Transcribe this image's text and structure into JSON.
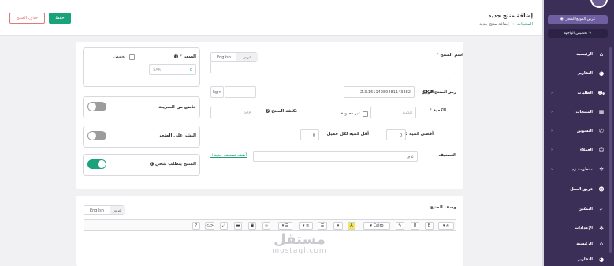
{
  "header": {
    "page_title": "إضافة منتج جديد",
    "breadcrumb": {
      "parent": "المنتجات",
      "current": "إضافة منتج جديد"
    },
    "save_label": "حفظ",
    "delete_label": "حذف المنتج"
  },
  "sidebar": {
    "store_button": "عرض الموقع/المتجر",
    "sub_item": "تخصيص الواجهة",
    "items": [
      {
        "label": "الرئيسية",
        "icon": "home-icon"
      },
      {
        "label": "التقارير",
        "icon": "chart-icon"
      },
      {
        "label": "الطلبات",
        "icon": "cart-icon"
      },
      {
        "label": "المنتجات",
        "icon": "grid-icon"
      },
      {
        "label": "التسويق",
        "icon": "megaphone-icon"
      },
      {
        "label": "العملاء",
        "icon": "users-icon"
      },
      {
        "label": "منظومة زد",
        "icon": "network-icon"
      },
      {
        "label": "فريق العمل",
        "icon": "team-icon"
      },
      {
        "label": "التمكين",
        "icon": "rocket-icon"
      },
      {
        "label": "الإعدادات",
        "icon": "gear-icon"
      },
      {
        "label": "الرئيسية",
        "icon": "home-icon"
      },
      {
        "label": "التقارير",
        "icon": "chart-icon"
      }
    ]
  },
  "form": {
    "product_name_label": "اسم المنتج",
    "lang_tabs": {
      "ar": "عربي",
      "en": "English"
    },
    "sku_label": "رمز المنتج SKU",
    "sku_value": "Z.3.16114289481143382",
    "weight_label": "الوزن",
    "weight_unit": "kg",
    "quantity_label": "الكمية",
    "quantity_placeholder": "الكمية",
    "unlimited_label": "غير محدودة",
    "cost_label": "تكلفة المنتج",
    "cost_placeholder": "SAR",
    "max_qty_label": "أقصى كمية لكل عميل",
    "min_qty_label": "أقل كمية لكل عميل",
    "max_qty_value": "0",
    "min_qty_value": "0",
    "category_label": "التصنيف",
    "category_value": "عام",
    "add_category_link": "+أضف تصنيف جديد",
    "price_label": "السعر",
    "discount_label": "تخفيض",
    "price_currency": "SAR",
    "price_value": "0",
    "tax_label": "خاضع من الضريبة",
    "publish_label": "النشر على المتجر",
    "shipping_label": "المنتج يتطلب شحن"
  },
  "description": {
    "label": "وصف المنتج",
    "tabs": {
      "ar": "عربي",
      "en": "English"
    },
    "toolbar": [
      "?",
      "</>",
      "⤢",
      "▬",
      "▣",
      "∞",
      "▾ ☰",
      "▾ ≡",
      "☰",
      "▾",
      "A",
      "▾ Cairo",
      "✎",
      "U",
      "B",
      "▾ ✍"
    ]
  },
  "watermark": {
    "arabic": "مستقل",
    "latin": "mostaql.com"
  }
}
